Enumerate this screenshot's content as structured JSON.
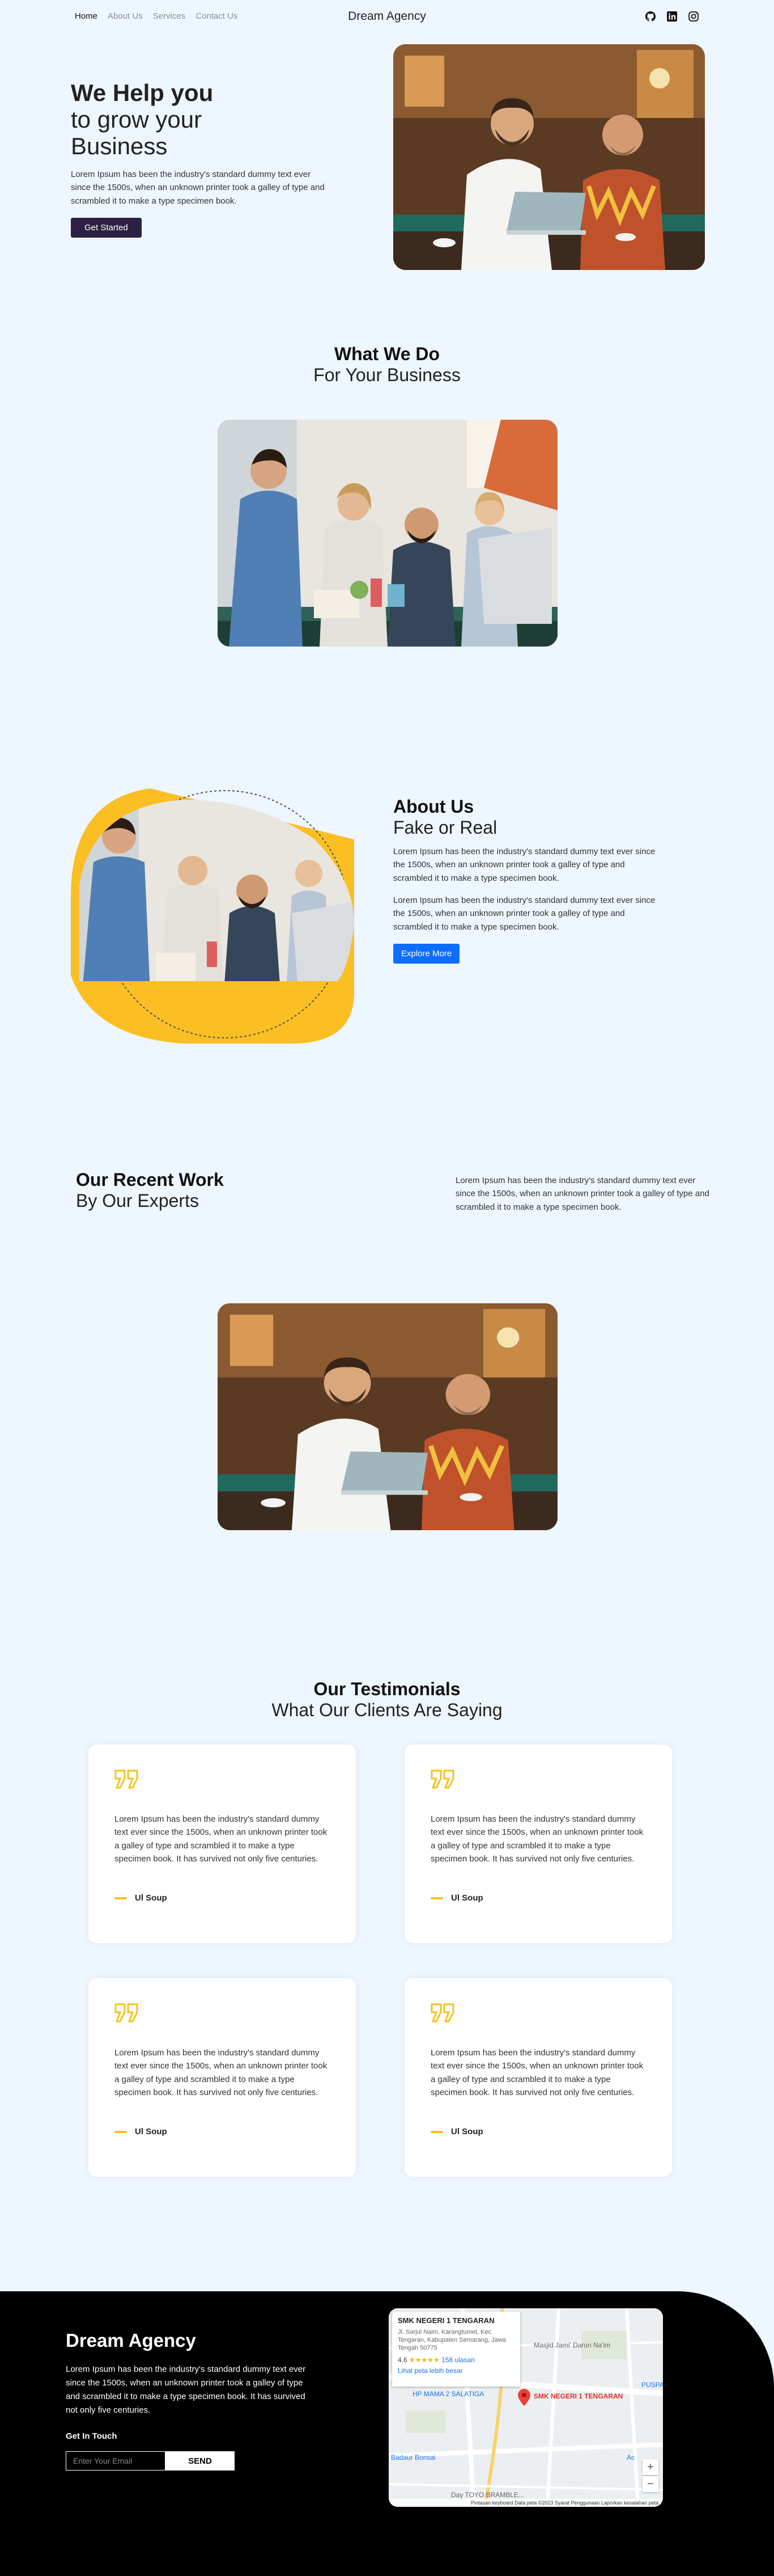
{
  "nav": {
    "links": [
      "Home",
      "About Us",
      "Services",
      "Contact Us"
    ],
    "brand": "Dream Agency",
    "social_icons": [
      "github-icon",
      "linkedin-icon",
      "instagram-icon"
    ]
  },
  "hero": {
    "title_bold": "We Help you",
    "title_line2": "to grow your",
    "title_line3": "Business",
    "text": "Lorem Ipsum has been the industry's standard dummy text ever since the 1500s, when an unknown printer took a galley of type and scrambled it to make a type specimen book.",
    "button": "Get Started"
  },
  "what_we_do": {
    "title_bold": "What We Do",
    "title_light": "For Your Business"
  },
  "about": {
    "title_bold": "About Us",
    "title_light": "Fake or Real",
    "para1": "Lorem Ipsum has been the industry's standard dummy text ever since the 1500s, when an unknown printer took a galley of type and scrambled it to make a type specimen book.",
    "para2": "Lorem Ipsum has been the industry's standard dummy text ever since the 1500s, when an unknown printer took a galley of type and scrambled it to make a type specimen book.",
    "button": "Explore More"
  },
  "recent_work": {
    "title_bold": "Our Recent Work",
    "title_light": "By Our Experts",
    "text": "Lorem Ipsum has been the industry's standard dummy text ever since the 1500s, when an unknown printer took a galley of type and scrambled it to make a type specimen book."
  },
  "testimonials": {
    "title_bold": "Our Testimonials",
    "title_light": "What Our Clients Are Saying",
    "items": [
      {
        "text": "Lorem Ipsum has been the industry's standard dummy text ever since the 1500s, when an unknown printer took a galley of type and scrambled it to make a type specimen book. It has survived not only five centuries.",
        "author": "Ul Soup"
      },
      {
        "text": "Lorem Ipsum has been the industry's standard dummy text ever since the 1500s, when an unknown printer took a galley of type and scrambled it to make a type specimen book. It has survived not only five centuries.",
        "author": "Ul Soup"
      },
      {
        "text": "Lorem Ipsum has been the industry's standard dummy text ever since the 1500s, when an unknown printer took a galley of type and scrambled it to make a type specimen book. It has survived not only five centuries.",
        "author": "Ul Soup"
      },
      {
        "text": "Lorem Ipsum has been the industry's standard dummy text ever since the 1500s, when an unknown printer took a galley of type and scrambled it to make a type specimen book. It has survived not only five centuries.",
        "author": "Ul Soup"
      }
    ]
  },
  "footer": {
    "brand": "Dream Agency",
    "text": "Lorem Ipsum has been the industry's standard dummy text ever since the 1500s, when an unknown printer took a galley of type and scrambled it to make a type specimen book. It has survived not only five centuries.",
    "get_in_touch": "Get In Touch",
    "email_placeholder": "Enter Your Email",
    "send": "SEND",
    "map": {
      "place_name": "SMK NEGERI 1 TENGARAN",
      "address": "Jl. Sarjul Naim, Karangtumet, Kec. Tengaran, Kabupaten Semarang, Jawa Tengah 50775",
      "rating": "4.6",
      "stars": "★★★★★",
      "reviews": "158 ulasan",
      "larger_map": "Lihat peta lebih besar",
      "labels": [
        "Masjid Jami' Darun Na'im",
        "PUSPA R",
        "HP MAMA 2 SALATIGA",
        "SMK NEGERI 1 TENGARAN",
        "Badaur Bonsai",
        "Ac",
        "Day TOYO BRAMBLE..."
      ],
      "zoom_in": "+",
      "zoom_out": "−",
      "attribution": "Pintasan keyboard   Data peta ©2023   Syarat Penggunaan   Laporkan kesalahan peta"
    }
  }
}
